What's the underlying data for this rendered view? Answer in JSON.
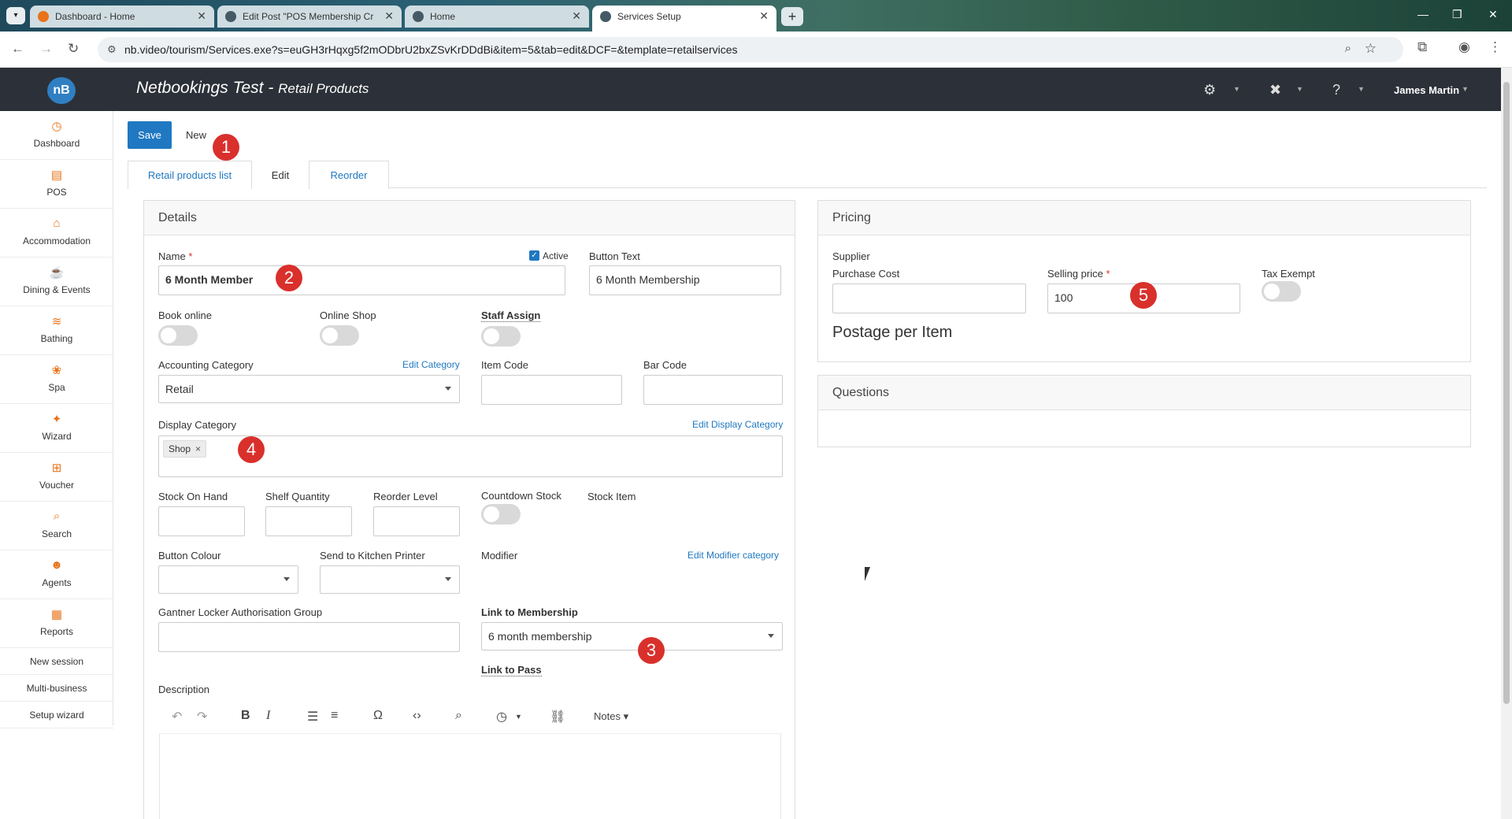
{
  "browser": {
    "tabs": [
      {
        "title": "Dashboard - Home"
      },
      {
        "title": "Edit Post \"POS Membership Cr"
      },
      {
        "title": "Home"
      },
      {
        "title": "Services Setup"
      }
    ],
    "url": "nb.video/tourism/Services.exe?s=euGH3rHqxg5f2mODbrU2bxZSvKrDDdBi&item=5&tab=edit&DCF=&template=retailservices"
  },
  "header": {
    "logo_text": "nB",
    "app_name": "Netbookings Test - ",
    "section": "Retail Products",
    "user": "James Martin"
  },
  "sidebar": {
    "items": [
      {
        "label": "Dashboard",
        "icon": "dashboard-icon"
      },
      {
        "label": "POS",
        "icon": "pos-icon"
      },
      {
        "label": "Accommodation",
        "icon": "bed-icon"
      },
      {
        "label": "Dining & Events",
        "icon": "dining-icon"
      },
      {
        "label": "Bathing",
        "icon": "waves-icon"
      },
      {
        "label": "Spa",
        "icon": "lotus-icon"
      },
      {
        "label": "Wizard",
        "icon": "wand-icon"
      },
      {
        "label": "Voucher",
        "icon": "gift-icon"
      },
      {
        "label": "Search",
        "icon": "search-icon"
      },
      {
        "label": "Agents",
        "icon": "people-icon"
      },
      {
        "label": "Reports",
        "icon": "report-icon"
      }
    ],
    "links": [
      "New session",
      "Multi-business",
      "Setup wizard"
    ]
  },
  "toolbar": {
    "save_label": "Save",
    "new_label": "New"
  },
  "page_tabs": [
    "Retail products list",
    "Edit",
    "Reorder"
  ],
  "annotations": [
    "1",
    "2",
    "3",
    "4",
    "5"
  ],
  "details": {
    "title": "Details",
    "name_label": "Name",
    "name_required": "*",
    "name_value": "6 Month Member",
    "active_label": "Active",
    "button_text_label": "Button Text",
    "button_text_value": "6 Month Membership",
    "book_online_label": "Book online",
    "online_shop_label": "Online Shop",
    "staff_assign_label": "Staff Assign",
    "accounting_category_label": "Accounting Category",
    "edit_category_link": "Edit Category",
    "accounting_category_value": "Retail",
    "item_code_label": "Item Code",
    "bar_code_label": "Bar Code",
    "display_category_label": "Display Category",
    "edit_display_category_link": "Edit Display Category",
    "display_category_tag": "Shop",
    "tag_remove": "×",
    "stock_on_hand_label": "Stock On Hand",
    "shelf_quantity_label": "Shelf Quantity",
    "reorder_level_label": "Reorder Level",
    "countdown_stock_label": "Countdown Stock",
    "stock_item_label": "Stock Item",
    "button_colour_label": "Button Colour",
    "kitchen_printer_label": "Send to Kitchen Printer",
    "modifier_label": "Modifier",
    "edit_modifier_link": "Edit Modifier category",
    "gantner_label": "Gantner Locker Authorisation Group",
    "link_membership_label": "Link to Membership",
    "link_membership_value": "6 month membership",
    "link_pass_label": "Link to Pass",
    "description_label": "Description",
    "editor_notes_label": "Notes"
  },
  "pricing": {
    "title": "Pricing",
    "supplier_label": "Supplier",
    "purchase_cost_label": "Purchase Cost",
    "selling_price_label": "Selling price",
    "selling_price_required": "*",
    "selling_price_value": "100",
    "tax_exempt_label": "Tax Exempt",
    "postage_label": "Postage per Item"
  },
  "questions": {
    "title": "Questions"
  },
  "colors": {
    "accent": "#1f78c1",
    "header_bg": "#2c3038",
    "sidebar_icon": "#e8731a",
    "badge": "#d9302c"
  }
}
